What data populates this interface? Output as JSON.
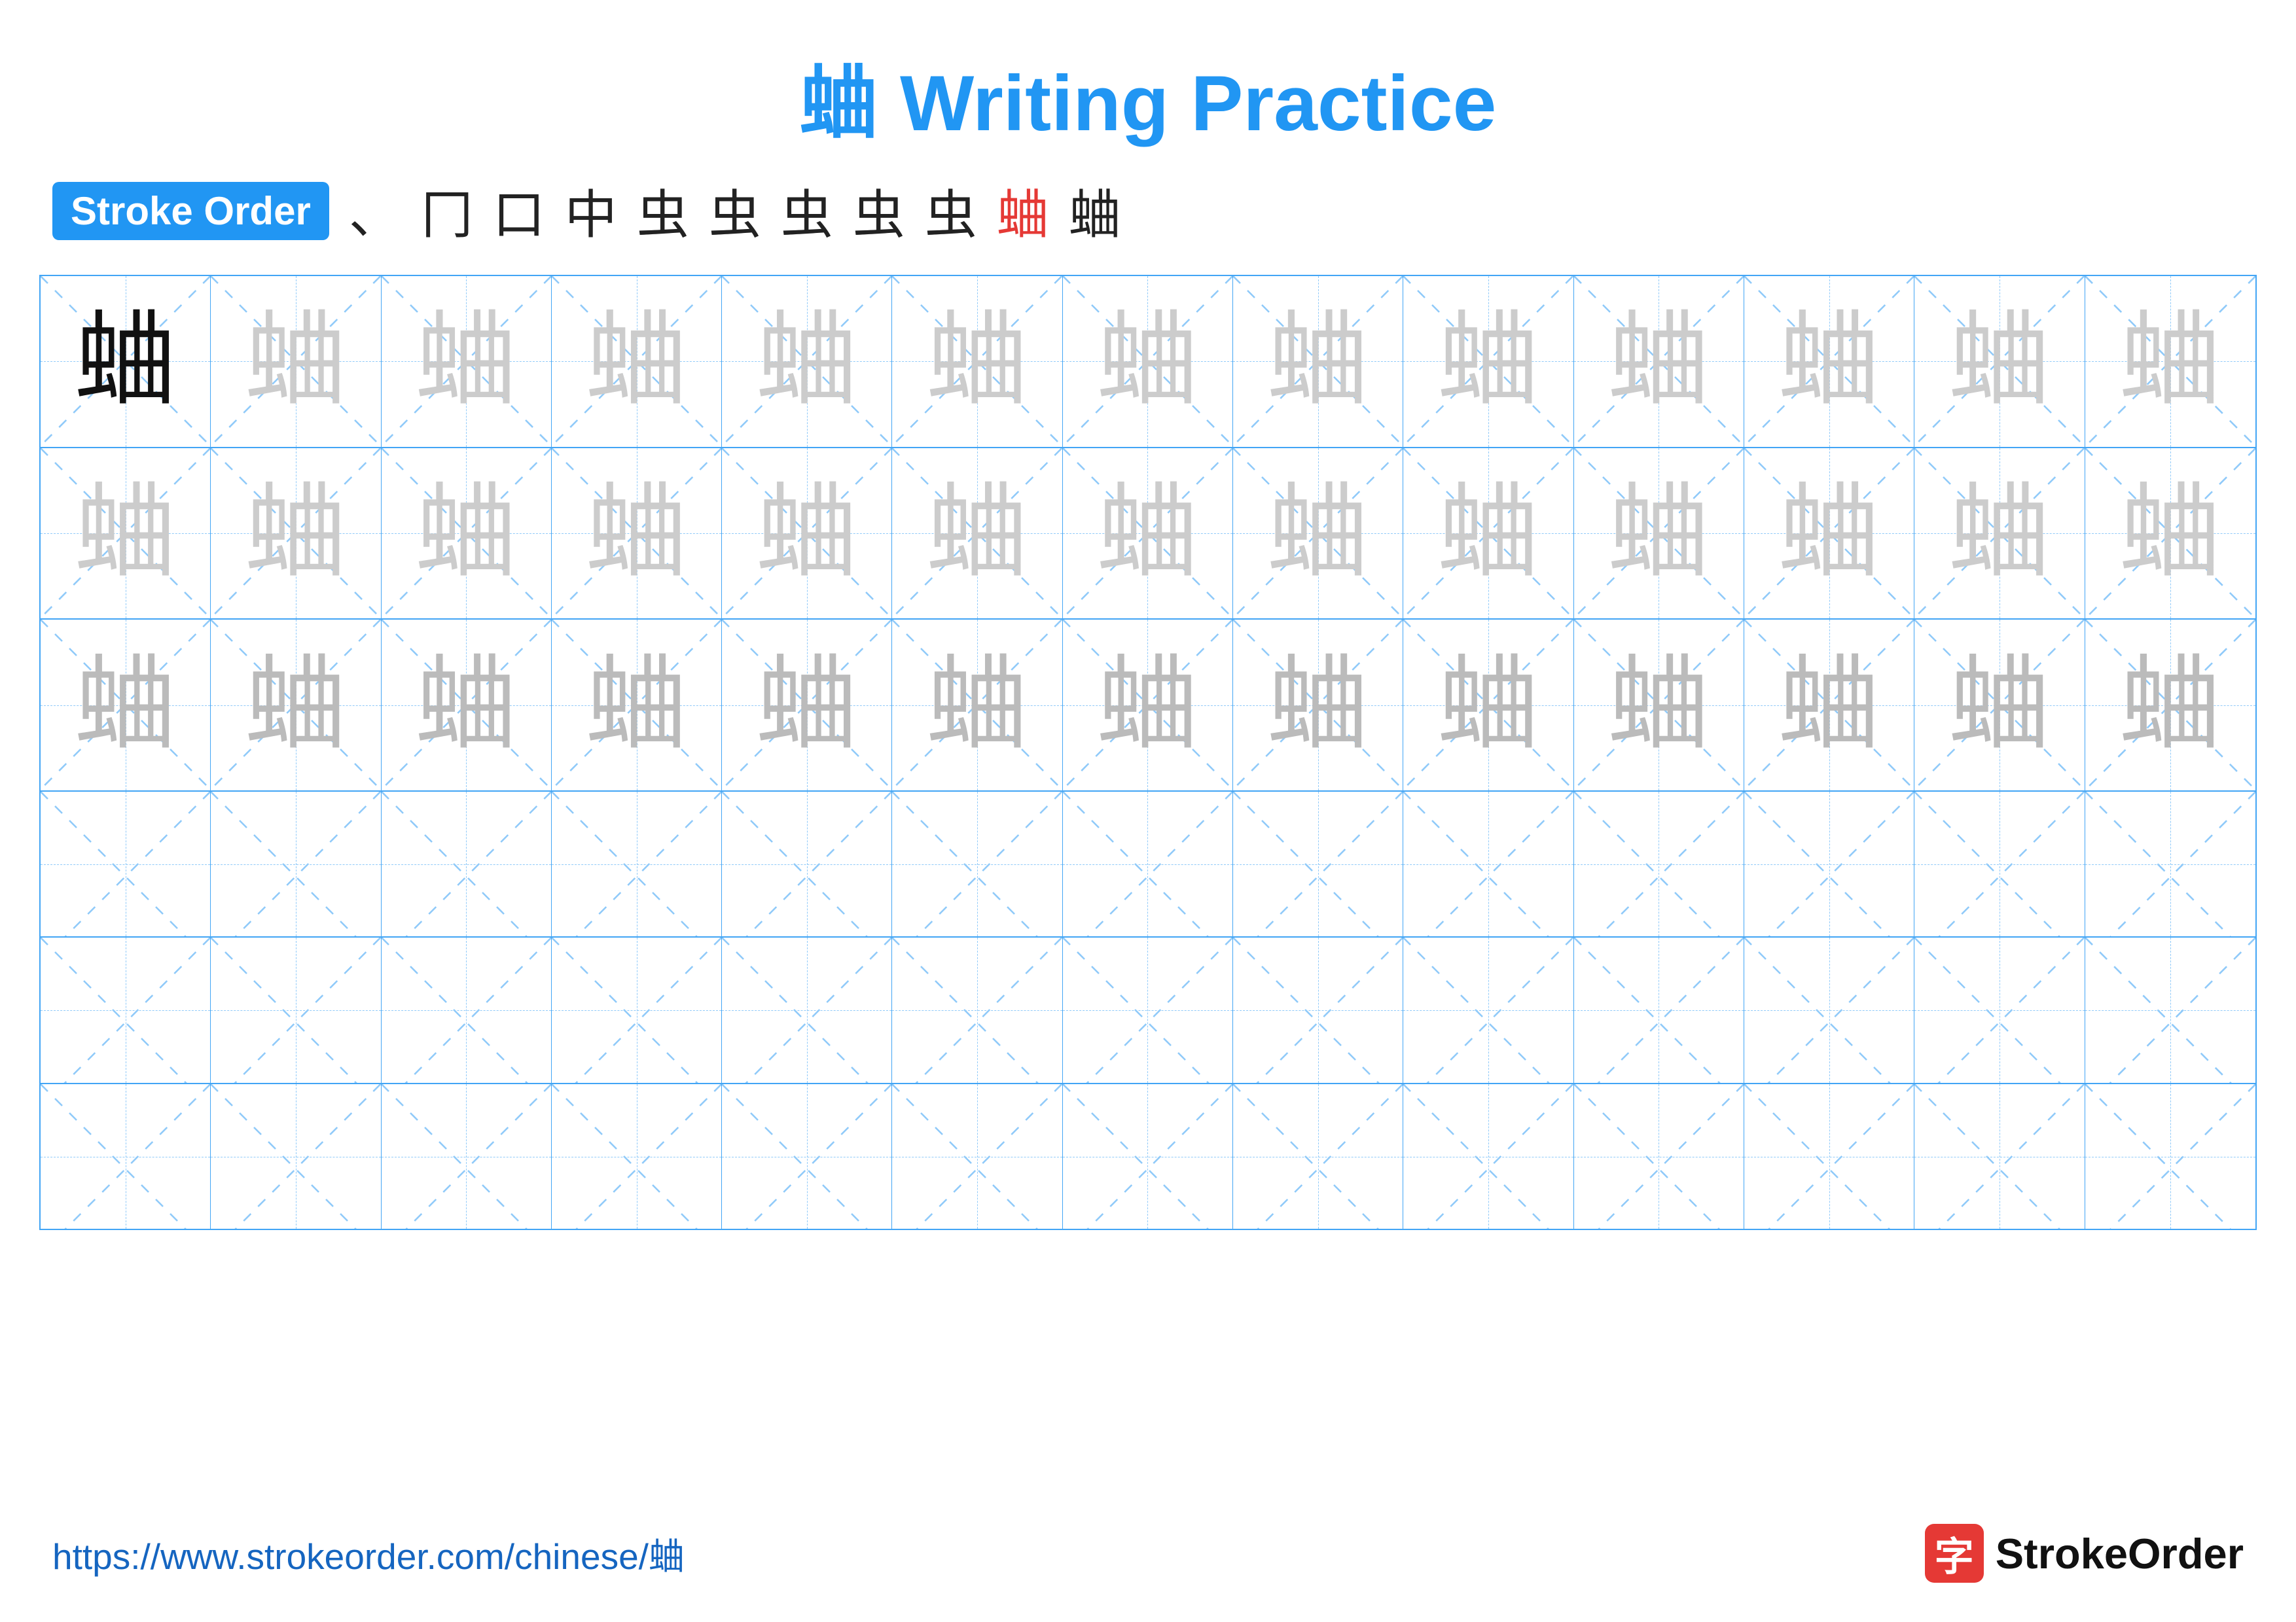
{
  "title": {
    "char": "蛐",
    "subtitle": "Writing Practice",
    "full": "蛐 Writing Practice"
  },
  "stroke_order": {
    "badge_label": "Stroke Order",
    "strokes": [
      "、",
      "冂",
      "口",
      "中",
      "虫",
      "虫",
      "虫",
      "虫",
      "虫",
      "蛐",
      "蛐"
    ],
    "red_index": 9
  },
  "grid": {
    "rows": 6,
    "cols": 13,
    "char": "蛐"
  },
  "footer": {
    "url": "https://www.strokeorder.com/chinese/蛐",
    "logo_char": "字",
    "logo_name": "StrokeOrder"
  }
}
